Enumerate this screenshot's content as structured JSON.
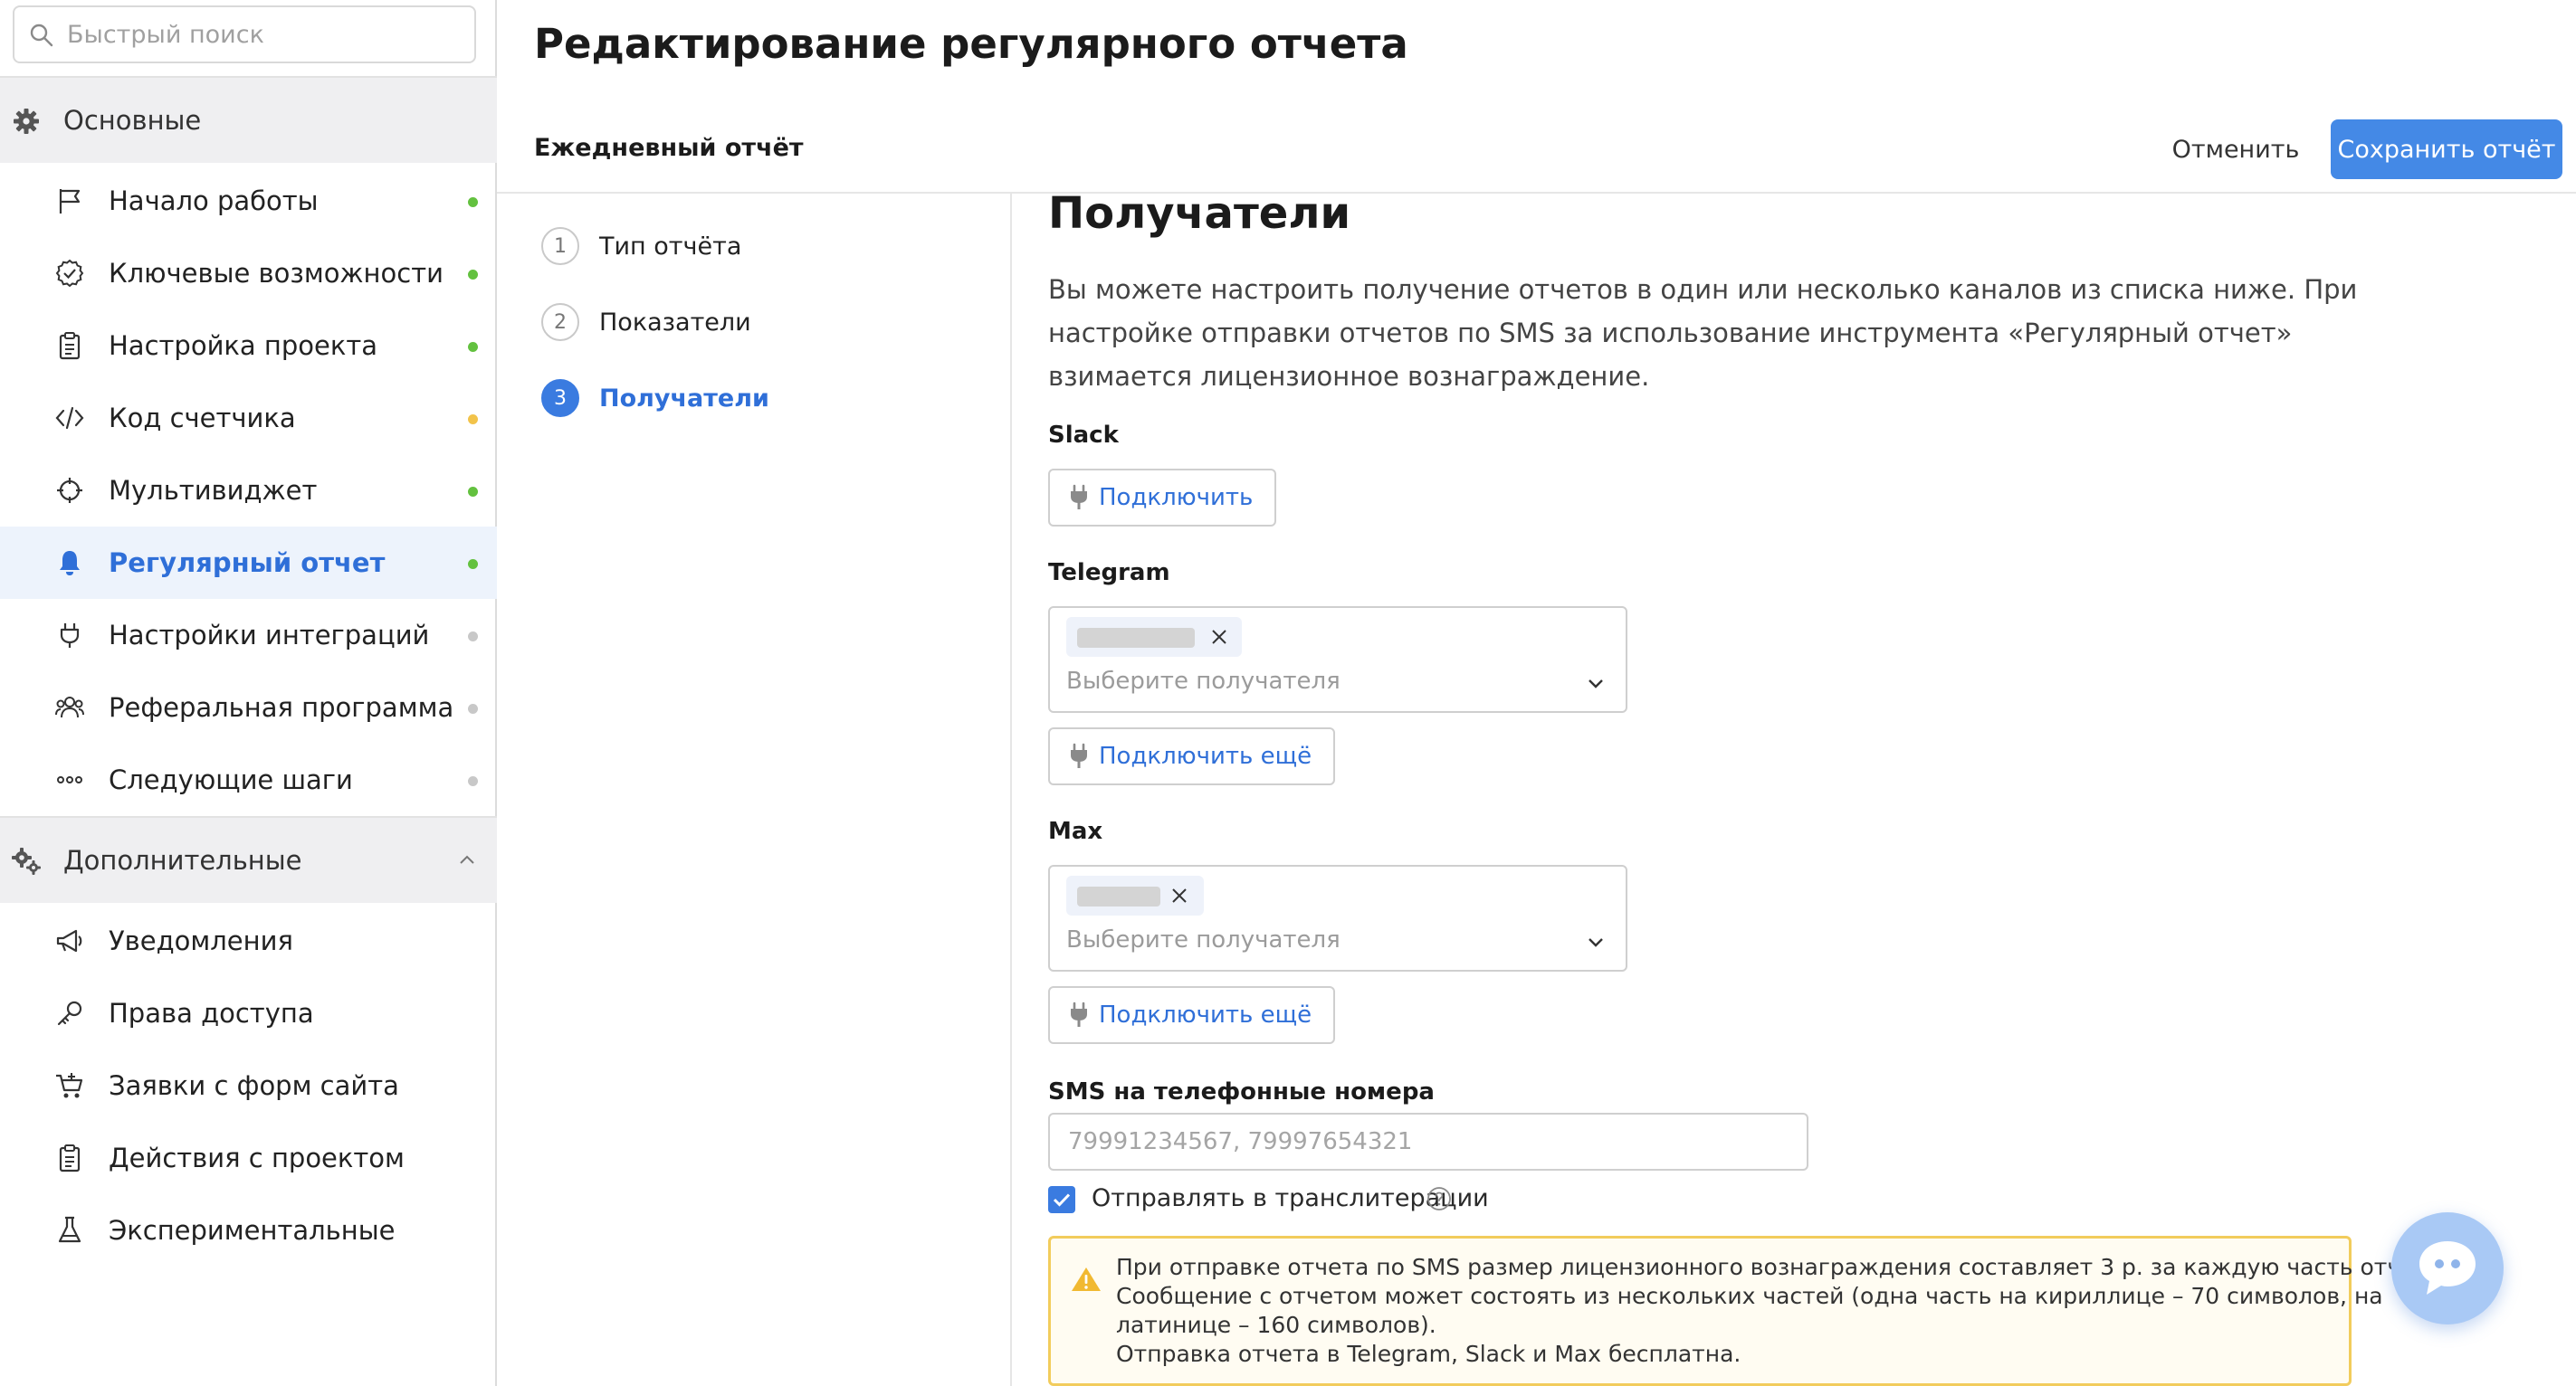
{
  "search": {
    "placeholder": "Быстрый поиск"
  },
  "sidebar": {
    "main_section": "Основные",
    "main_items": [
      {
        "label": "Начало работы",
        "dot": "#63c13f"
      },
      {
        "label": "Ключевые возможности",
        "dot": "#63c13f"
      },
      {
        "label": "Настройка проекта",
        "dot": "#63c13f"
      },
      {
        "label": "Код счетчика",
        "dot": "#f2c34a"
      },
      {
        "label": "Мультивиджет",
        "dot": "#63c13f"
      },
      {
        "label": "Регулярный отчет",
        "dot": "#63c13f"
      },
      {
        "label": "Настройки интеграций",
        "dot": "#c8c8c8"
      },
      {
        "label": "Реферальная программа",
        "dot": "#c8c8c8"
      },
      {
        "label": "Следующие шаги",
        "dot": "#c8c8c8"
      }
    ],
    "extra_section": "Дополнительные",
    "extra_items": [
      {
        "label": "Уведомления"
      },
      {
        "label": "Права доступа"
      },
      {
        "label": "Заявки с форм сайта"
      },
      {
        "label": "Действия с проектом"
      },
      {
        "label": "Экспериментальные"
      }
    ]
  },
  "header": {
    "title": "Редактирование регулярного отчета",
    "report_name": "Ежедневный отчёт",
    "cancel": "Отменить",
    "save": "Сохранить отчёт"
  },
  "steps": [
    {
      "num": "1",
      "label": "Тип отчёта"
    },
    {
      "num": "2",
      "label": "Показатели"
    },
    {
      "num": "3",
      "label": "Получатели"
    }
  ],
  "recipients": {
    "title": "Получатели",
    "description": "Вы можете настроить получение отчетов в один или несколько каналов из списка ниже. При настройке отправки отчетов по SMS за использование инструмента «Регулярный отчет» взимается лицензионное вознаграждение.",
    "slack": {
      "label": "Slack",
      "connect": "Подключить"
    },
    "telegram": {
      "label": "Telegram",
      "placeholder": "Выберите получателя",
      "connect_more": "Подключить ещё"
    },
    "max": {
      "label": "Max",
      "placeholder": "Выберите получателя",
      "connect_more": "Подключить ещё"
    },
    "sms": {
      "label": "SMS на телефонные номера",
      "placeholder": "79991234567, 79997654321",
      "translit_label": "Отправлять в транслитерации"
    },
    "alert_lines": [
      "При отправке отчета по SMS размер лицензионного вознаграждения составляет 3 р. за каждую часть отчета.",
      "Сообщение с отчетом может состоять из нескольких частей (одна часть на кириллице – 70 символов, на",
      "латинице – 160 символов).",
      "Отправка отчета в Telegram, Slack и Max бесплатна."
    ]
  },
  "colors": {
    "accent": "#3a7be0",
    "save_button": "#4489e6",
    "active_bg": "#edf3fc",
    "warning_border": "#f2cc5c"
  }
}
